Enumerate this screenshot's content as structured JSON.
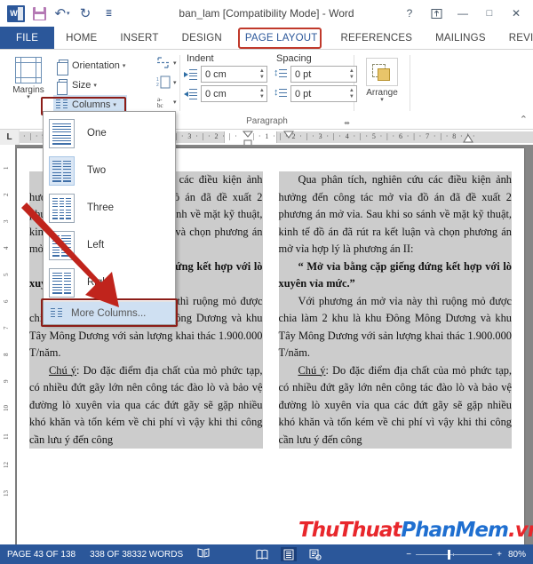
{
  "window": {
    "title": "ban_lam [Compatibility Mode] - Word",
    "quick_access": [
      {
        "name": "word-logo",
        "label": "W"
      },
      {
        "name": "save-icon",
        "label": "Save"
      },
      {
        "name": "undo-icon",
        "label": "↶"
      },
      {
        "name": "redo-icon",
        "label": "↻"
      },
      {
        "name": "customize-qat-icon",
        "label": "¯"
      }
    ],
    "controls": [
      {
        "name": "help-button",
        "label": "?"
      },
      {
        "name": "ribbon-display-options-button",
        "label": "⤒"
      },
      {
        "name": "minimize-button",
        "label": "—"
      },
      {
        "name": "maximize-button",
        "label": "□"
      },
      {
        "name": "close-button",
        "label": "✕"
      }
    ]
  },
  "ribbon": {
    "tabs": [
      {
        "label": "FILE",
        "active_file": true
      },
      {
        "label": "HOME"
      },
      {
        "label": "INSERT"
      },
      {
        "label": "DESIGN"
      },
      {
        "label": "PAGE LAYOUT",
        "highlighted": true
      },
      {
        "label": "REFERENCES"
      },
      {
        "label": "MAILINGS"
      },
      {
        "label": "REVI"
      }
    ],
    "scroll_arrow": "▸",
    "page_setup": {
      "margins_label": "Margins",
      "orientation_label": "Orientation",
      "size_label": "Size",
      "columns_label": "Columns",
      "caret": "▾"
    },
    "paragraph": {
      "group_label": "Paragraph",
      "indent_label": "Indent",
      "spacing_label": "Spacing",
      "indent_left_value": "0 cm",
      "indent_right_value": "0 cm",
      "spacing_before_value": "0 pt",
      "spacing_after_value": "0 pt",
      "dialog_launcher": "⬌"
    },
    "arrange": {
      "label": "Arrange",
      "caret": "▾"
    },
    "collapse_icon": "⌃"
  },
  "columns_menu": {
    "items": [
      {
        "label": "One",
        "cols": 1,
        "selected": false
      },
      {
        "label": "Two",
        "cols": 2,
        "selected": true
      },
      {
        "label": "Three",
        "cols": 3,
        "selected": false
      },
      {
        "label": "Left",
        "cols": 2,
        "selected": false
      },
      {
        "label": "Right",
        "cols": 2,
        "selected": false
      }
    ],
    "more_label": "More Columns...",
    "more_highlighted": true
  },
  "ruler": {
    "tab_stop_marker": "L",
    "horizontal_ticks_left": "· | · 9 ·",
    "horizontal_ticks": "· | · 3 · | · 2 · | ·",
    "horizontal_ticks_right": "· | · 1 · | · 2 · | · 3 · | · 4 · | · 5 · | · 6 · | · 7 · | · 8 · | ·",
    "vertical_ticks": [
      "1",
      "2",
      "3",
      "4",
      "5",
      "6",
      "7",
      "8",
      "9",
      "10",
      "11",
      "12",
      "13"
    ]
  },
  "document": {
    "left_column": {
      "p1": "Qua phân tích, nghiên cứu các điều kiện ảnh hưởng đến công tác mở vỉa đồ án đã đề xuất 2 phương án mở vỉa. Sau khi so sánh về mặt kỹ thuật, kinh tế đồ án đã rút ra kết luận và chọn phương án mở vỉa hợp lý là phương án II:",
      "p2": "“ Mở vỉa bằng cặp giếng đứng kết hợp với lò xuyên vỉa mức.”",
      "p3": "Với phương án mở vỉa này thì ruộng mỏ được chia làm 2 khu là khu Đông Mông Dương và khu Tây Mông Dương với sản lượng khai thác 1.900.000 T/năm.",
      "p4_label": "Chú ý",
      "p4": ": Do đặc điểm địa chất của mỏ phức tạp, có nhiều đứt gãy lớn nên công tác đào lò và bảo vệ đường lò xuyên vỉa qua các đứt gãy sẽ gặp nhiều khó khăn và tốn kém về chi phí vì vậy khi thi công cần lưu ý đến công"
    },
    "right_column": {
      "p1": "Qua phân tích, nghiên cứu các điều kiện ảnh hưởng đến công tác mở vỉa đồ án đã đề xuất 2 phương án mở vỉa. Sau khi so sánh về mặt kỹ thuật, kinh tế đồ án đã rút ra kết luận và chọn phương án mở vỉa hợp lý là phương án II:",
      "p2": "“ Mở vỉa bằng cặp giếng đứng kết hợp với lò xuyên vỉa mức.”",
      "p3": "Với phương án mở vỉa này thì ruộng mỏ được chia làm 2 khu là khu Đông Mông Dương và khu Tây Mông Dương với sản lượng khai thác 1.900.000 T/năm.",
      "p4_label": "Chú ý",
      "p4": ": Do đặc điểm địa chất của mỏ phức tạp, có nhiều đứt gãy lớn nên công tác đào lò và bảo vệ đường lò xuyên vỉa qua các đứt gãy sẽ gặp nhiều khó khăn và tốn kém về chi phí vì vậy khi thi công cần lưu ý đến công"
    }
  },
  "watermark": {
    "part1": "ThuThuat",
    "part2": "PhanMem",
    "part3": ".vn"
  },
  "statusbar": {
    "page": "PAGE 43 OF 138",
    "words": "338 OF 38332 WORDS",
    "proofing_icon": "⧉",
    "views": [
      {
        "name": "read-mode-view",
        "glyph": "☰"
      },
      {
        "name": "print-layout-view",
        "glyph": "▤",
        "selected": true
      },
      {
        "name": "web-layout-view",
        "glyph": "▥"
      }
    ],
    "zoom_out": "−",
    "zoom_in": "+",
    "zoom_level": "80%"
  },
  "colors": {
    "word_blue": "#2b579a",
    "highlight_red": "#c0392b",
    "menu_selected": "#cfe0f2"
  }
}
